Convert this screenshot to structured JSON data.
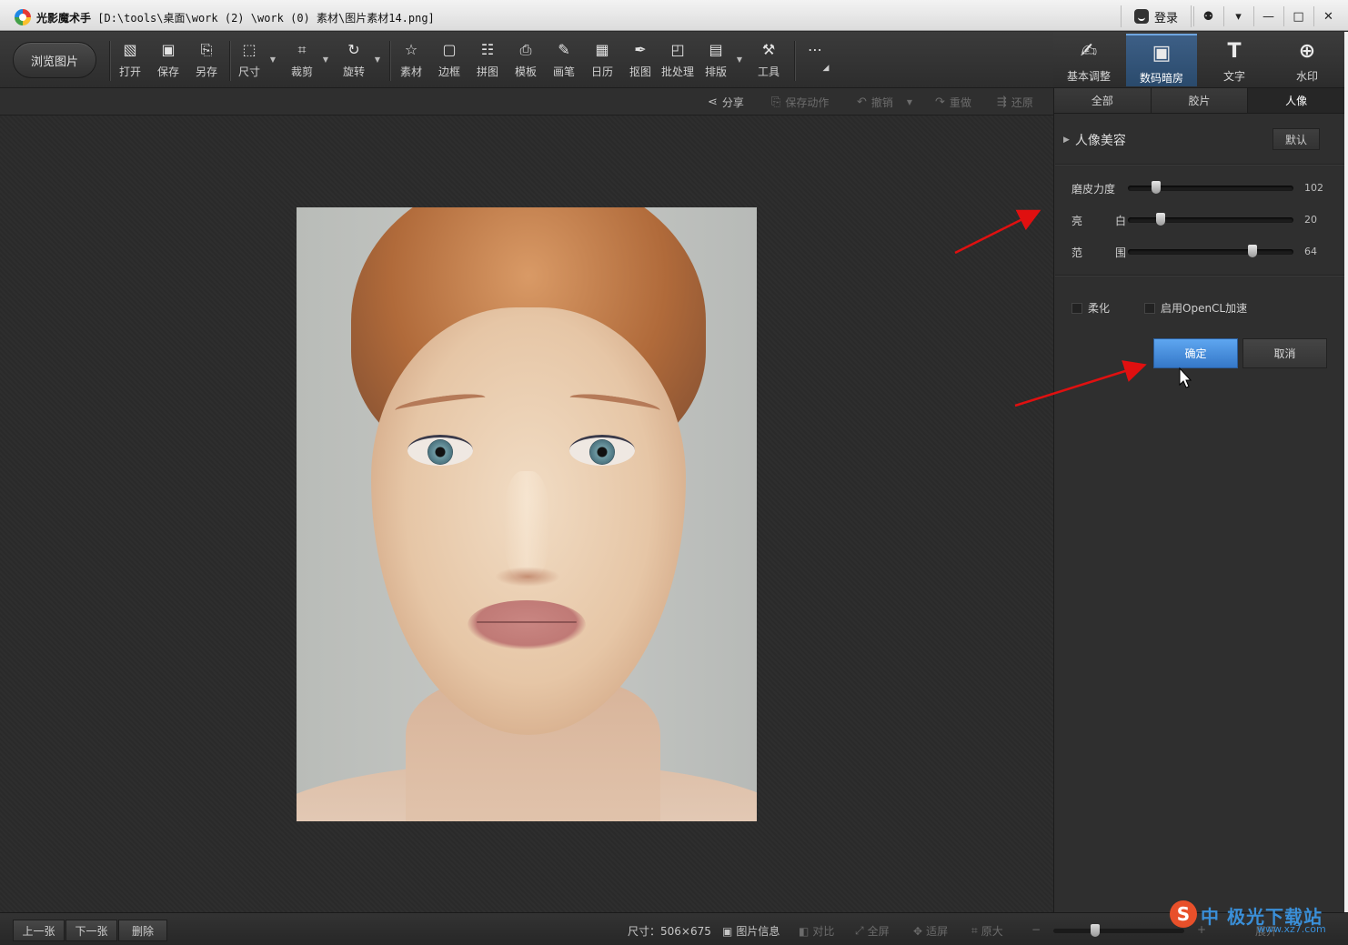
{
  "window": {
    "app_name": "光影魔术手",
    "file_path": "[D:\\tools\\桌面\\work (2) \\work (0) 素材\\图片素材14.png]",
    "login_label": "登录",
    "controls": [
      "⚉",
      "▾",
      "—",
      "□",
      "✕"
    ]
  },
  "toolbar": {
    "browse_label": "浏览图片",
    "tools": [
      {
        "label": "打开",
        "icon": "▧"
      },
      {
        "label": "保存",
        "icon": "▣"
      },
      {
        "label": "另存",
        "icon": "⎘"
      },
      {
        "label": "尺寸",
        "icon": "⬚"
      },
      {
        "label": "裁剪",
        "icon": "⌗"
      },
      {
        "label": "旋转",
        "icon": "↻"
      },
      {
        "label": "素材",
        "icon": "☆"
      },
      {
        "label": "边框",
        "icon": "▢"
      },
      {
        "label": "拼图",
        "icon": "☷"
      },
      {
        "label": "模板",
        "icon": "⎙"
      },
      {
        "label": "画笔",
        "icon": "✎"
      },
      {
        "label": "日历",
        "icon": "▦"
      },
      {
        "label": "抠图",
        "icon": "✒"
      },
      {
        "label": "批处理",
        "icon": "◰"
      },
      {
        "label": "排版",
        "icon": "▤"
      },
      {
        "label": "工具",
        "icon": "⚒"
      }
    ],
    "more": "⋯"
  },
  "modes": [
    {
      "label": "基本调整",
      "icon": "✍",
      "active": false
    },
    {
      "label": "数码暗房",
      "icon": "▣",
      "active": true
    },
    {
      "label": "文字",
      "icon": "T",
      "active": false
    },
    {
      "label": "水印",
      "icon": "⊕",
      "active": false
    }
  ],
  "actions": {
    "share": "分享",
    "save_action": "保存动作",
    "undo": "撤销",
    "redo": "重做",
    "restore": "还原"
  },
  "panel": {
    "subtabs": [
      "全部",
      "胶片",
      "人像"
    ],
    "active_subtab": "人像",
    "section_title": "人像美容",
    "default_btn": "默认",
    "sliders": [
      {
        "label": "磨皮力度",
        "label2": "",
        "value": "102",
        "fraction": 0.17
      },
      {
        "label": "亮",
        "label2": "白",
        "value": "20",
        "fraction": 0.2
      },
      {
        "label": "范",
        "label2": "围",
        "value": "64",
        "fraction": 0.75
      }
    ],
    "soften_label": "柔化",
    "opencl_label": "启用OpenCL加速",
    "ok_label": "确定",
    "cancel_label": "取消"
  },
  "statusbar": {
    "prev": "上一张",
    "next": "下一张",
    "delete": "删除",
    "size_label": "尺寸：506×675",
    "image_info": "图片信息",
    "compare": "对比",
    "fullscreen": "全屏",
    "fit": "适屏",
    "original": "原大",
    "zoom_minus": "−",
    "zoom_plus": "+",
    "expand": "展开"
  },
  "watermark": {
    "logo_letter": "S",
    "text": "中 极光下载站",
    "sub": "www.xz7.com"
  }
}
